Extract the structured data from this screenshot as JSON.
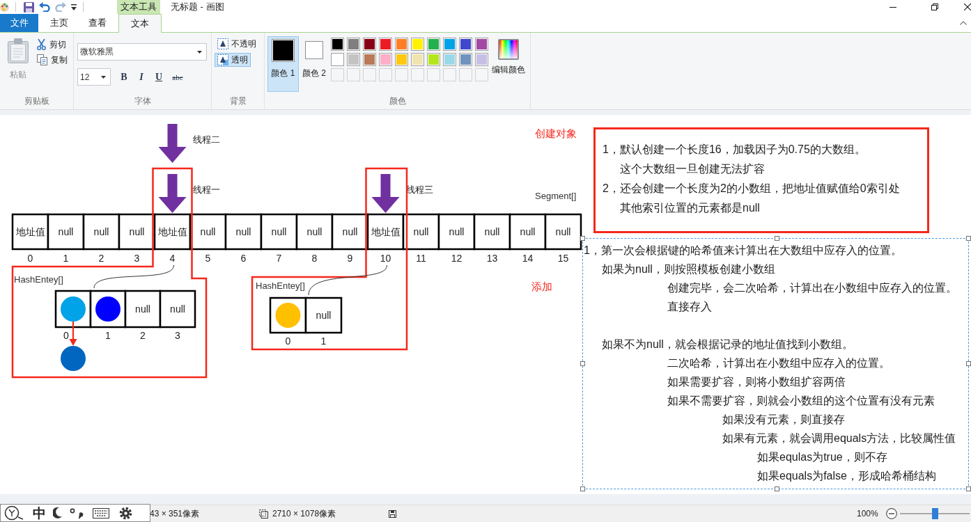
{
  "title_bar": {
    "context_tab": "文本工具",
    "title": "无标题 - 画图"
  },
  "tabs": [
    {
      "label": "文件",
      "kind": "file",
      "selected": false
    },
    {
      "label": "主页",
      "kind": "tab",
      "selected": false
    },
    {
      "label": "查看",
      "kind": "tab",
      "selected": false
    },
    {
      "label": "文本",
      "kind": "tab",
      "selected": true
    }
  ],
  "ribbon": {
    "clipboard": {
      "label": "剪贴板",
      "paste": {
        "label": "粘贴",
        "disabled": true
      },
      "cut": {
        "label": "剪切"
      },
      "copy": {
        "label": "复制"
      }
    },
    "font": {
      "label": "字体",
      "family": "微软雅黑",
      "size": "12",
      "styles": [
        {
          "kind": "bold",
          "label": "B"
        },
        {
          "kind": "italic",
          "label": "I"
        },
        {
          "kind": "underline",
          "label": "U"
        },
        {
          "kind": "strikethrough",
          "label": "abc"
        }
      ]
    },
    "background": {
      "label": "背景",
      "options": [
        {
          "kind": "opaque",
          "label": "不透明",
          "selected": false
        },
        {
          "kind": "transparent",
          "label": "透明",
          "selected": true
        }
      ]
    },
    "colors": {
      "label": "颜色",
      "slots": [
        {
          "label": "颜色 1",
          "color": "#000000",
          "selected": true
        },
        {
          "label": "颜色 2",
          "color": "#ffffff",
          "selected": false
        }
      ],
      "palette": [
        {
          "kind": "swatch",
          "color": "#000000"
        },
        {
          "kind": "swatch",
          "color": "#7f7f7f"
        },
        {
          "kind": "swatch",
          "color": "#880015"
        },
        {
          "kind": "swatch",
          "color": "#ed1c24"
        },
        {
          "kind": "swatch",
          "color": "#ff7f27"
        },
        {
          "kind": "swatch",
          "color": "#fff200"
        },
        {
          "kind": "swatch",
          "color": "#22b14c"
        },
        {
          "kind": "swatch",
          "color": "#00a2e8"
        },
        {
          "kind": "swatch",
          "color": "#3f48cc"
        },
        {
          "kind": "swatch",
          "color": "#a349a4"
        },
        {
          "kind": "swatch",
          "color": "#ffffff"
        },
        {
          "kind": "swatch",
          "color": "#c3c3c3"
        },
        {
          "kind": "swatch",
          "color": "#b97a57"
        },
        {
          "kind": "swatch",
          "color": "#ffaec9"
        },
        {
          "kind": "swatch",
          "color": "#ffc90e"
        },
        {
          "kind": "swatch",
          "color": "#efe4b0"
        },
        {
          "kind": "swatch",
          "color": "#b5e61d"
        },
        {
          "kind": "swatch",
          "color": "#99d9ea"
        },
        {
          "kind": "swatch",
          "color": "#7092be"
        },
        {
          "kind": "swatch",
          "color": "#c8bfe7"
        },
        {
          "kind": "empty"
        },
        {
          "kind": "empty"
        },
        {
          "kind": "empty"
        },
        {
          "kind": "empty"
        },
        {
          "kind": "empty"
        },
        {
          "kind": "empty"
        },
        {
          "kind": "empty"
        },
        {
          "kind": "empty"
        },
        {
          "kind": "empty"
        },
        {
          "kind": "empty"
        }
      ],
      "edit": {
        "label": "编辑颜色"
      }
    }
  },
  "canvas": {
    "create_label": "创建对象",
    "add_label": "添加",
    "segment_array": {
      "label": "Segment[]",
      "cells": [
        {
          "value": "地址值",
          "index": "0"
        },
        {
          "value": "null",
          "index": "1"
        },
        {
          "value": "null",
          "index": "2"
        },
        {
          "value": "null",
          "index": "3"
        },
        {
          "value": "地址值",
          "index": "4",
          "threads": [
            "线程二",
            "线程一"
          ],
          "table": {
            "label": "HashEntey[]",
            "entries": [
              {
                "kind": "node",
                "color": "#00a2e8",
                "index": "0",
                "chain": [
                  {
                    "color": "#0066c0"
                  }
                ]
              },
              {
                "kind": "node",
                "color": "#0000ff",
                "index": "1"
              },
              {
                "kind": "value",
                "value": "null",
                "index": "2"
              },
              {
                "kind": "value",
                "value": "null",
                "index": "3"
              }
            ]
          }
        },
        {
          "value": "null",
          "index": "5"
        },
        {
          "value": "null",
          "index": "6"
        },
        {
          "value": "null",
          "index": "7"
        },
        {
          "value": "null",
          "index": "8"
        },
        {
          "value": "null",
          "index": "9"
        },
        {
          "value": "地址值",
          "index": "10",
          "threads": [
            "线程三"
          ],
          "table": {
            "label": "HashEntey[]",
            "entries": [
              {
                "kind": "node",
                "color": "#ffc000",
                "index": "0"
              },
              {
                "kind": "value",
                "value": "null",
                "index": "1"
              }
            ]
          }
        },
        {
          "value": "null",
          "index": "11"
        },
        {
          "value": "null",
          "index": "12"
        },
        {
          "value": "null",
          "index": "13"
        },
        {
          "value": "null",
          "index": "14"
        },
        {
          "value": "null",
          "index": "15"
        }
      ]
    },
    "create_notes": [
      {
        "text": "1，默认创建一个长度16，加载因子为0.75的大数组。",
        "children": [
          {
            "text": "这个大数组一旦创建无法扩容"
          }
        ]
      },
      {
        "text": "2，还会创建一个长度为2的小数组，把地址值赋值给0索引处",
        "children": [
          {
            "text": "其他索引位置的元素都是null"
          }
        ]
      }
    ],
    "add_notes": [
      {
        "text": "1，第一次会根据键的哈希值来计算出在大数组中应存入的位置。",
        "children": [
          {
            "text": "如果为null，则按照模板创建小数组",
            "children": [
              {
                "text": "创建完毕，会二次哈希，计算出在小数组中应存入的位置。"
              },
              {
                "text": "直接存入"
              }
            ]
          },
          {
            "text": "如果不为null，就会根据记录的地址值找到小数组。",
            "children": [
              {
                "text": "二次哈希，计算出在小数组中应存入的位置。"
              },
              {
                "text": "如果需要扩容，则将小数组扩容两倍"
              },
              {
                "text": "如果不需要扩容，则就会小数组的这个位置有没有元素",
                "children": [
                  {
                    "text": "如果没有元素，则直接存"
                  },
                  {
                    "text": "如果有元素，就会调用equals方法，比较属性值",
                    "children": [
                      {
                        "text": "如果equlas为true，则不存"
                      },
                      {
                        "text": "如果equals为false，形成哈希桶结构"
                      }
                    ]
                  }
                ]
              }
            ]
          }
        ]
      }
    ]
  },
  "status_bar": {
    "cursor_position": "43 × 351像素",
    "selection_size": "2710 × 1078像素",
    "zoom": "100%",
    "zoom_slider": {
      "level": 0.5
    }
  },
  "ime_toolbar": {
    "mode": "中"
  }
}
